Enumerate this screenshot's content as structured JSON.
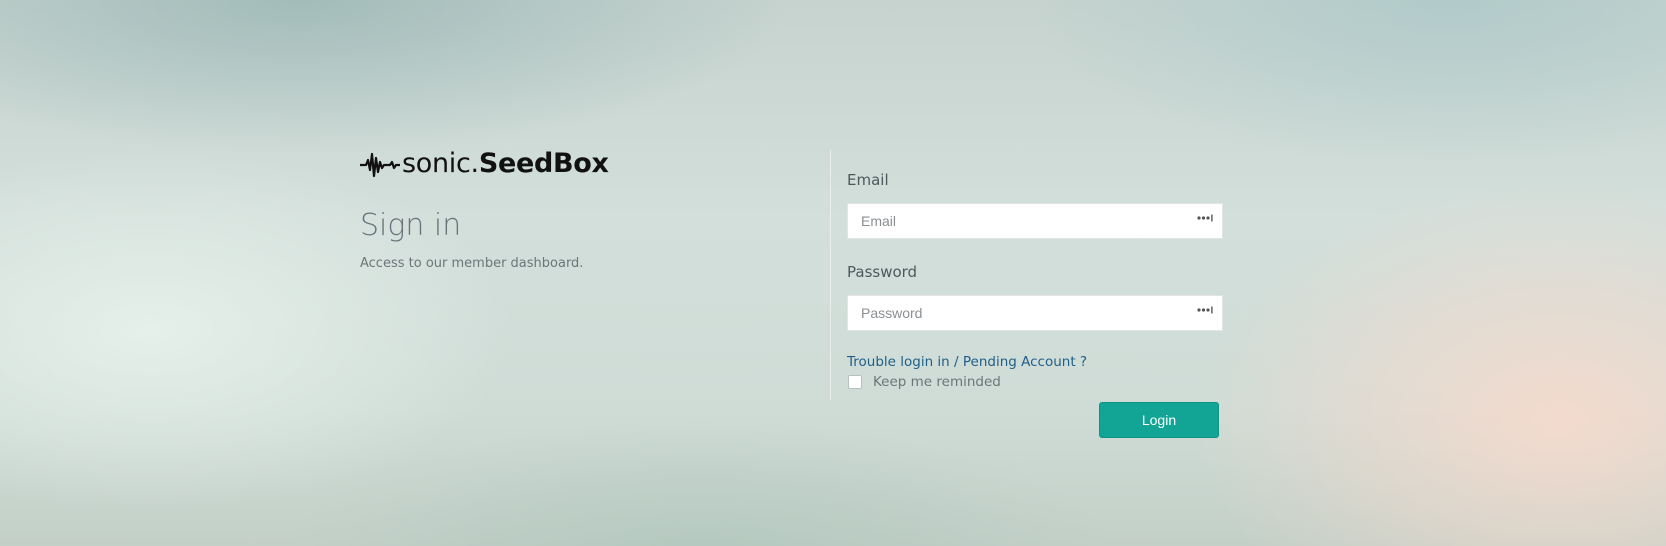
{
  "brand": {
    "logo_light": "sonic.",
    "logo_bold": "SeedBox",
    "logo_icon": "waveform-icon"
  },
  "intro": {
    "title": "Sign in",
    "subtitle": "Access to our member dashboard."
  },
  "form": {
    "email_label": "Email",
    "email_placeholder": "Email",
    "email_value": "",
    "password_label": "Password",
    "password_placeholder": "Password",
    "password_value": "",
    "field_icon": "password-manager-icon",
    "trouble_link": "Trouble login in / Pending Account ?",
    "remember_label": "Keep me reminded",
    "remember_checked": false,
    "login_label": "Login"
  },
  "colors": {
    "accent": "#12a596",
    "link": "#1e5f8a",
    "title": "#69727a"
  }
}
